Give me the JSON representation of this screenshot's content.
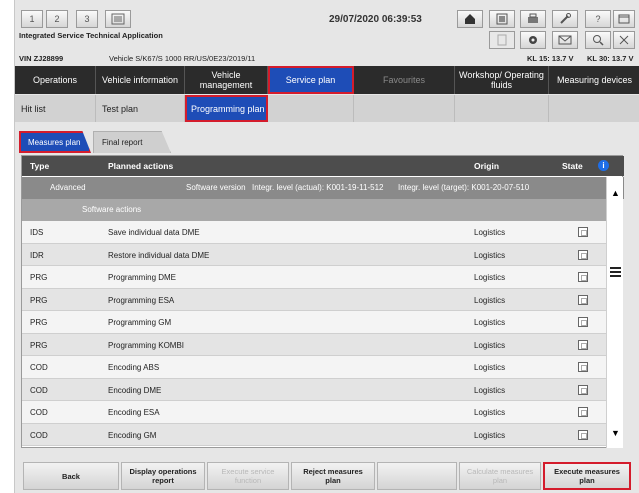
{
  "toolbar": {
    "num_buttons": [
      "1",
      "2",
      "3"
    ],
    "datetime": "29/07/2020 06:39:53",
    "icons": [
      "list-icon",
      "home-icon",
      "vehicle-status-icon",
      "print-icon",
      "wrench-icon",
      "help-icon",
      "window-icon",
      "close-icon"
    ]
  },
  "app": {
    "title": "Integrated Service Technical Application",
    "icons": [
      "document-icon",
      "settings-gear-icon",
      "mail-icon",
      "search-zoom-icon",
      "close-icon"
    ]
  },
  "vehicle": {
    "vin": "VIN  ZJ28899",
    "vehicle": "Vehicle  S/K67/S 1000 RR/US/0E23/2019/11",
    "kl15": "KL 15:  13.7 V",
    "kl30": "KL 30:  13.7 V"
  },
  "main_nav": [
    {
      "label": "Operations",
      "state": "normal"
    },
    {
      "label": "Vehicle information",
      "state": "normal"
    },
    {
      "label": "Vehicle management",
      "state": "normal"
    },
    {
      "label": "Service plan",
      "state": "active"
    },
    {
      "label": "Favourites",
      "state": "dim"
    },
    {
      "label": "Workshop/ Operating fluids",
      "state": "normal"
    },
    {
      "label": "Measuring devices",
      "state": "normal"
    }
  ],
  "sub_nav": [
    {
      "label": "Hit list"
    },
    {
      "label": "Test plan"
    },
    {
      "label": "Programming plan"
    }
  ],
  "tabs": [
    {
      "label": "Measures plan"
    },
    {
      "label": "Final report"
    }
  ],
  "table": {
    "headers": {
      "type": "Type",
      "planned": "Planned actions",
      "origin": "Origin",
      "state": "State"
    },
    "advanced": {
      "type": "Advanced",
      "software": "Software version",
      "actual": "Integr. level (actual): K001-19-11-512",
      "target": "Integr. level (target): K001-20-07-510"
    },
    "section": "Software actions",
    "rows": [
      {
        "type": "IDS",
        "action": "Save individual data DME",
        "origin": "Logistics"
      },
      {
        "type": "IDR",
        "action": "Restore individual data DME",
        "origin": "Logistics"
      },
      {
        "type": "PRG",
        "action": "Programming DME",
        "origin": "Logistics"
      },
      {
        "type": "PRG",
        "action": "Programming ESA",
        "origin": "Logistics"
      },
      {
        "type": "PRG",
        "action": "Programming GM",
        "origin": "Logistics"
      },
      {
        "type": "PRG",
        "action": "Programming KOMBI",
        "origin": "Logistics"
      },
      {
        "type": "COD",
        "action": "Encoding ABS",
        "origin": "Logistics"
      },
      {
        "type": "COD",
        "action": "Encoding DME",
        "origin": "Logistics"
      },
      {
        "type": "COD",
        "action": "Encoding ESA",
        "origin": "Logistics"
      },
      {
        "type": "COD",
        "action": "Encoding GM",
        "origin": "Logistics"
      }
    ]
  },
  "footer": {
    "back": "Back",
    "display_ops": "Display operations report",
    "execute_service": "Execute service function",
    "reject": "Reject measures plan",
    "calculate": "Calculate measures plan",
    "execute_plan": "Execute measures plan"
  }
}
